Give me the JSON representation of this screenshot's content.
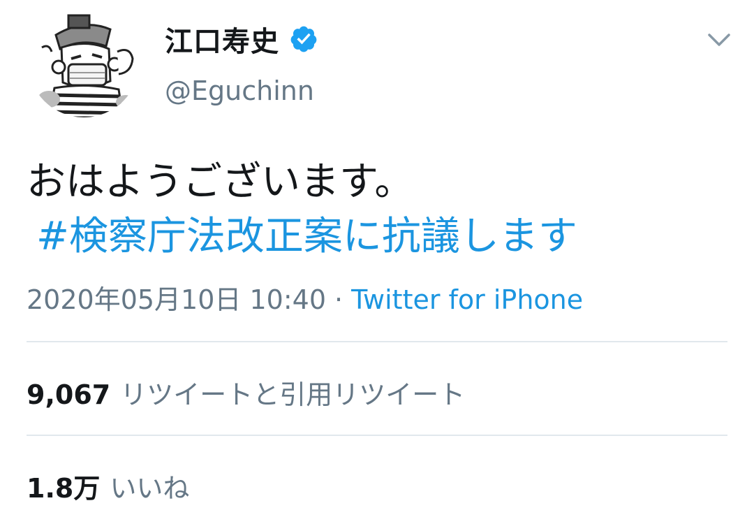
{
  "tweet": {
    "author": {
      "display_name": "江口寿史",
      "handle": "@Eguchinn",
      "verified": true
    },
    "text": "おはようございます。",
    "hashtag": "#検察庁法改正案に抗議します",
    "timestamp": "2020年05月10日 10:40",
    "separator": "·",
    "source": "Twitter for iPhone",
    "stats": {
      "retweets": {
        "count": "9,067",
        "label": "リツイートと引用リツイート"
      },
      "likes": {
        "count": "1.8万",
        "label": "いいね"
      }
    }
  },
  "icons": {
    "verified": "verified-badge-icon",
    "menu": "chevron-down-icon"
  },
  "colors": {
    "link": "#1b95e0",
    "secondary_text": "#657786",
    "primary_text": "#14171a",
    "divider": "#e1e8ed"
  }
}
